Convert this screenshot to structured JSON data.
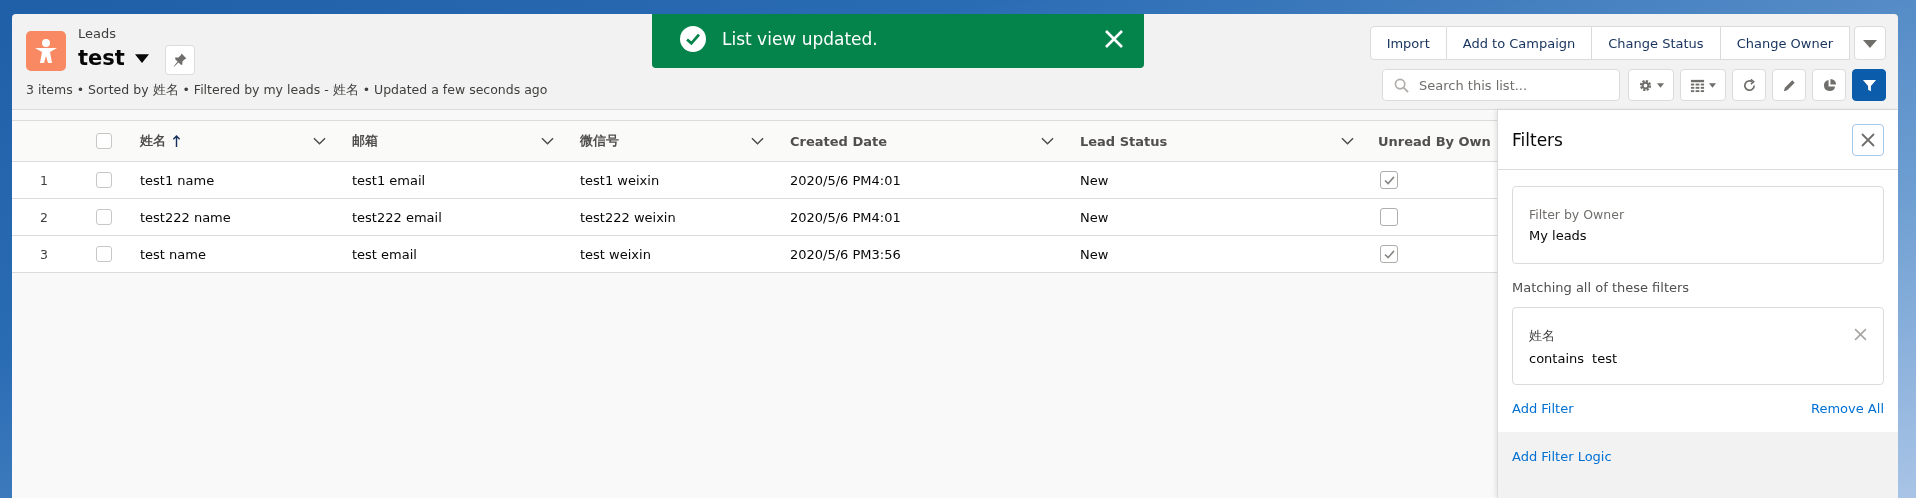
{
  "header": {
    "object_label": "Leads",
    "title": "test",
    "summary": "3 items • Sorted by 姓名 • Filtered by my leads - 姓名 • Updated a few seconds ago"
  },
  "toast": {
    "message": "List view updated."
  },
  "actions": [
    "Import",
    "Add to Campaign",
    "Change Status",
    "Change Owner"
  ],
  "search": {
    "placeholder": "Search this list..."
  },
  "tools": [
    {
      "kind": "settings",
      "selected": false
    },
    {
      "kind": "display",
      "selected": false
    },
    {
      "kind": "refresh",
      "selected": false
    },
    {
      "kind": "edit",
      "selected": false
    },
    {
      "kind": "chart",
      "selected": false
    },
    {
      "kind": "filter",
      "selected": true
    }
  ],
  "table": {
    "all_selected": false,
    "columns": [
      {
        "label": "姓名",
        "sorted": true,
        "menu": true
      },
      {
        "label": "邮箱",
        "sorted": false,
        "menu": true
      },
      {
        "label": "微信号",
        "sorted": false,
        "menu": true
      },
      {
        "label": "Created Date",
        "sorted": false,
        "menu": true
      },
      {
        "label": "Lead Status",
        "sorted": false,
        "menu": true
      },
      {
        "label": "Unread By Own",
        "sorted": false,
        "menu": false
      }
    ],
    "rows": [
      {
        "number": "1",
        "selected": false,
        "name": "test1 name",
        "email": "test1 email",
        "weixin": "test1 weixin",
        "created": "2020/5/6 PM4:01",
        "status": "New",
        "unread": true
      },
      {
        "number": "2",
        "selected": false,
        "name": "test222 name",
        "email": "test222 email",
        "weixin": "test222 weixin",
        "created": "2020/5/6 PM4:01",
        "status": "New",
        "unread": false
      },
      {
        "number": "3",
        "selected": false,
        "name": "test name",
        "email": "test email",
        "weixin": "test weixin",
        "created": "2020/5/6 PM3:56",
        "status": "New",
        "unread": true
      }
    ]
  },
  "filters": {
    "title": "Filters",
    "owner": {
      "label": "Filter by Owner",
      "value": "My leads"
    },
    "section": "Matching all of these filters",
    "items": [
      {
        "field": "姓名",
        "operator": "contains",
        "value": "test"
      }
    ],
    "add_link": "Add Filter",
    "remove_link": "Remove All",
    "logic_link": "Add Filter Logic"
  }
}
